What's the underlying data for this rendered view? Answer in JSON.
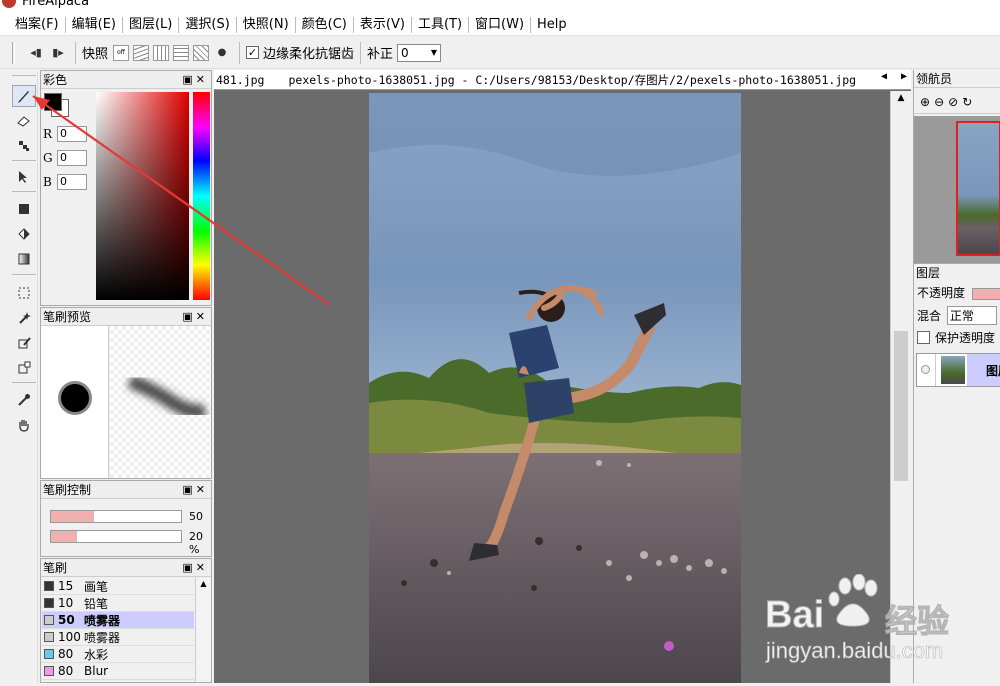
{
  "app": {
    "title": "FireAlpaca"
  },
  "menu": [
    "档案(F)",
    "编辑(E)",
    "图层(L)",
    "選択(S)",
    "快照(N)",
    "颜色(C)",
    "表示(V)",
    "工具(T)",
    "窗口(W)",
    "Help"
  ],
  "toolbar": {
    "snap_label": "快照",
    "antialias_label": "边缘柔化抗锯齿",
    "antialias_checked": "✓",
    "correction_label": "补正",
    "correction_value": "0"
  },
  "color_panel": {
    "title": "彩色",
    "r_label": "R",
    "g_label": "G",
    "b_label": "B",
    "r": "0",
    "g": "0",
    "b": "0"
  },
  "brush_preview": {
    "title": "笔刷预览"
  },
  "brush_control": {
    "title": "笔刷控制",
    "size_value": "50",
    "opacity_value": "20 %",
    "size_fraction": 0.33,
    "opacity_fraction": 0.2
  },
  "brush_list": {
    "title": "笔刷",
    "items": [
      {
        "size": "15",
        "name": "画笔",
        "color": "#333333"
      },
      {
        "size": "10",
        "name": "铅笔",
        "color": "#333333"
      },
      {
        "size": "50",
        "name": "喷雾器",
        "color": "#cccccc"
      },
      {
        "size": "100",
        "name": "喷雾器",
        "color": "#cccccc"
      },
      {
        "size": "80",
        "name": "水彩",
        "color": "#66ccee"
      },
      {
        "size": "80",
        "name": "Blur",
        "color": "#ee99ee"
      }
    ]
  },
  "document": {
    "tab_prev": "481.jpg",
    "tab_title": "pexels-photo-1638051.jpg - C:/Users/98153/Desktop/存图片/2/pexels-photo-1638051.jpg"
  },
  "navigator": {
    "title": "领航员"
  },
  "layers": {
    "title": "图层",
    "opacity_label": "不透明度",
    "blend_label": "混合",
    "blend_value": "正常",
    "protect_label": "保护透明度",
    "layer_name": "图层"
  },
  "watermark": {
    "logo": "Bai",
    "cn": "经验",
    "url": "jingyan.baidu.com"
  }
}
